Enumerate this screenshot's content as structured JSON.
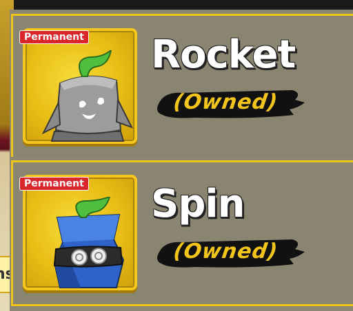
{
  "background": {
    "side_tab_text": "ns"
  },
  "items": [
    {
      "name": "Rocket",
      "badge": "Permanent",
      "status": "(Owned)",
      "icon": "rocket-fruit-icon",
      "color": "#8e8e8e"
    },
    {
      "name": "Spin",
      "badge": "Permanent",
      "status": "(Owned)",
      "icon": "spin-fruit-icon",
      "color": "#2a5cc0"
    }
  ],
  "colors": {
    "accent": "#f0c419",
    "badge": "#d8262b",
    "card_bg": "#8a8570",
    "owned_text": "#f3c51b"
  }
}
